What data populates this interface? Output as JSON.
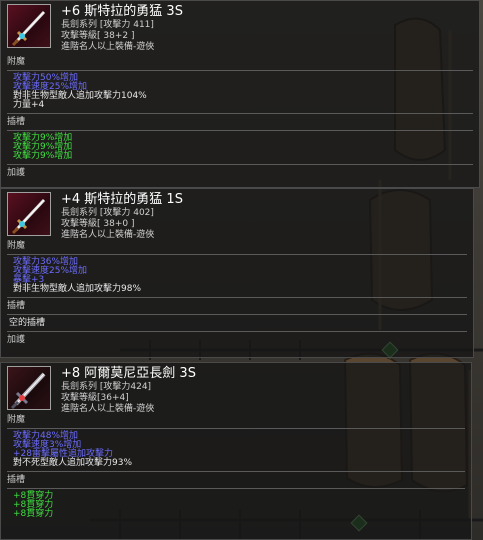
{
  "items": [
    {
      "title": "+6 斯特拉的勇猛 3S",
      "weapon_type": "長劍系列 [攻擊力 411]",
      "attack_level": "攻擊等級[ 38+2 ]",
      "requirement": "進階名人以上裝備-遊俠",
      "enchant_label": "附魔",
      "enchant_options": [
        {
          "text": "攻擊力50%增加",
          "color": "blue"
        },
        {
          "text": "攻擊速度25%增加",
          "color": "blue"
        },
        {
          "text": "對非生物型敵人追加攻擊力104%",
          "color": "white"
        },
        {
          "text": "力量+4",
          "color": "white"
        }
      ],
      "socket_label": "插槽",
      "socket_options": [
        "攻擊力9%增加",
        "攻擊力9%增加",
        "攻擊力9%增加"
      ],
      "boost_label": "加護"
    },
    {
      "title": "+4 斯特拉的勇猛 1S",
      "weapon_type": "長劍系列 [攻擊力 402]",
      "attack_level": "攻擊等級[ 38+0 ]",
      "requirement": "進階名人以上裝備-遊俠",
      "enchant_label": "附魔",
      "enchant_options": [
        {
          "text": "攻擊力36%增加",
          "color": "blue"
        },
        {
          "text": "攻擊速度25%增加",
          "color": "blue"
        },
        {
          "text": "暴擊+3",
          "color": "blue"
        },
        {
          "text": "對非生物型敵人追加攻擊力98%",
          "color": "white"
        }
      ],
      "socket_label": "插槽",
      "empty_socket": "空的插槽",
      "boost_label": "加護"
    },
    {
      "title": "+8 阿爾莫尼亞長劍 3S",
      "weapon_type": "長劍系列 [攻擊力424]",
      "attack_level": "攻擊等級[36+4]",
      "requirement": "進階名人以上裝備-遊俠",
      "enchant_label": "附魔",
      "enchant_options": [
        {
          "text": "攻擊力48%增加",
          "color": "blue"
        },
        {
          "text": "攻擊速度3%增加",
          "color": "blue"
        },
        {
          "text": "+28雷擊屬性追加攻擊力",
          "color": "blue"
        },
        {
          "text": "對不死型敵人追加攻擊力93%",
          "color": "white"
        }
      ],
      "socket_label": "插槽",
      "socket_options": [
        "+8貫穿力",
        "+8貫穿力",
        "+8貫穿力"
      ]
    }
  ]
}
